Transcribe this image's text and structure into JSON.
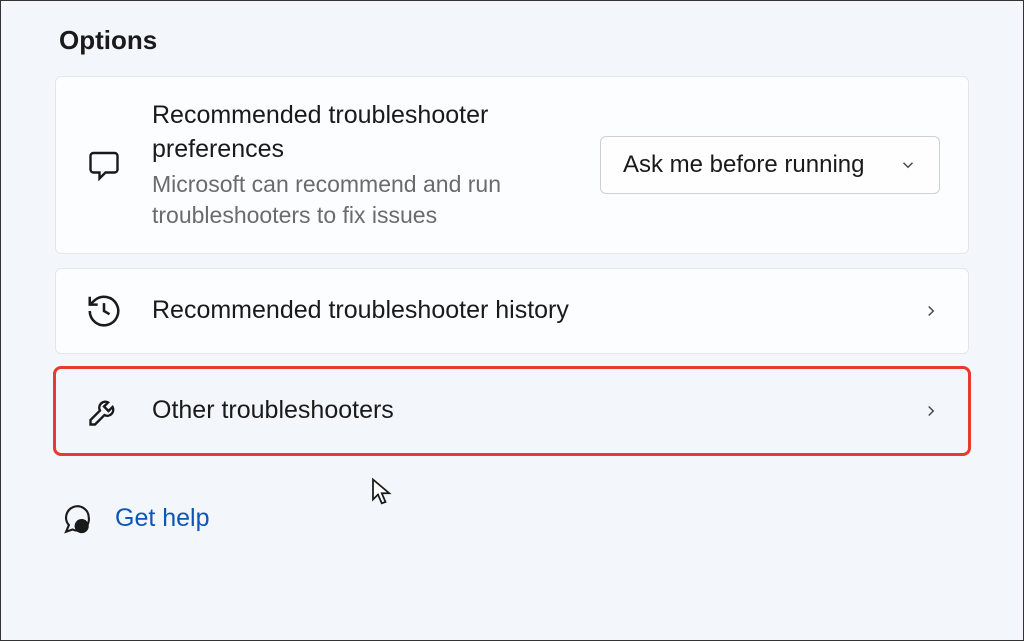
{
  "section_title": "Options",
  "cards": {
    "preferences": {
      "title": "Recommended troubleshooter preferences",
      "desc": "Microsoft can recommend and run troubleshooters to fix issues",
      "dropdown_value": "Ask me before running"
    },
    "history": {
      "title": "Recommended troubleshooter history"
    },
    "other": {
      "title": "Other troubleshooters"
    }
  },
  "help": {
    "label": "Get help"
  }
}
